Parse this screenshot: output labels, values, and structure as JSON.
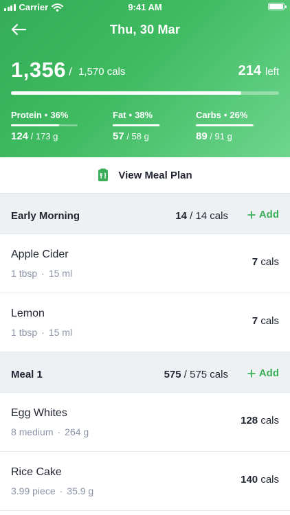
{
  "status_bar": {
    "carrier": "Carrier",
    "time": "9:41 AM"
  },
  "nav": {
    "title": "Thu, 30 Mar"
  },
  "summary": {
    "consumed": "1,356",
    "slash": "/",
    "goal": "1,570 cals",
    "remaining": "214",
    "remaining_label": "left",
    "progress_fraction": 0.86
  },
  "macros": [
    {
      "name": "Protein",
      "percent": "36%",
      "consumed": "124",
      "target": "/ 173 g",
      "fraction": 0.72
    },
    {
      "name": "Fat",
      "percent": "38%",
      "consumed": "57",
      "target": "/ 58 g",
      "fraction": 0.98
    },
    {
      "name": "Carbs",
      "percent": "26%",
      "consumed": "89",
      "target": "/ 91 g",
      "fraction": 0.98
    }
  ],
  "meal_plan": {
    "label": "View Meal Plan",
    "icon": "meal-plan-icon"
  },
  "sections": [
    {
      "title": "Early Morning",
      "cals_consumed": "14",
      "cals_total": "/ 14 cals",
      "add_label": "Add",
      "items": [
        {
          "name": "Apple Cider",
          "qty": "1",
          "unit": "tbsp",
          "amount": "15",
          "amount_unit": "ml",
          "cals": "7",
          "cals_unit": "cals"
        },
        {
          "name": "Lemon",
          "qty": "1",
          "unit": "tbsp",
          "amount": "15",
          "amount_unit": "ml",
          "cals": "7",
          "cals_unit": "cals"
        }
      ]
    },
    {
      "title": "Meal 1",
      "cals_consumed": "575",
      "cals_total": "/ 575 cals",
      "add_label": "Add",
      "items": [
        {
          "name": "Egg Whites",
          "qty": "8",
          "unit": "medium",
          "amount": "264",
          "amount_unit": "g",
          "cals": "128",
          "cals_unit": "cals"
        },
        {
          "name": "Rice Cake",
          "qty": "3.99",
          "unit": "piece",
          "amount": "35.9",
          "amount_unit": "g",
          "cals": "140",
          "cals_unit": "cals"
        }
      ]
    }
  ],
  "colors": {
    "accent": "#3cae5a",
    "header_start": "#34ad56",
    "header_end": "#6fd58f",
    "muted_text": "#8a93a6",
    "section_bg": "#eef1f4"
  }
}
